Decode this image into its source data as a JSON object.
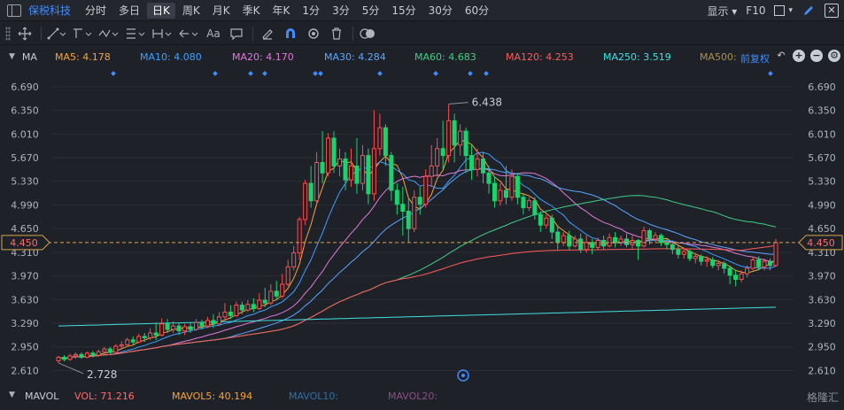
{
  "topbar": {
    "stock_name": "保税科技",
    "periods": [
      "分时",
      "多日",
      "日K",
      "周K",
      "月K",
      "季K",
      "年K",
      "1分",
      "3分",
      "5分",
      "15分",
      "30分",
      "60分"
    ],
    "active_period": "日K",
    "display_label": "显示",
    "f10_label": "F10"
  },
  "toolbar": {
    "text_tool_label": "Aa",
    "icons": [
      "move-icon",
      "line-icon",
      "polyline-icon",
      "wave-icon",
      "range-icon",
      "arrow-left-icon",
      "text-icon",
      "comment-icon",
      "eraser-icon",
      "magnet-icon",
      "eye-icon",
      "trash-icon",
      "toggle-icon"
    ]
  },
  "ma_bar": {
    "indicator": "MA",
    "items": [
      {
        "label": "MA5: 4.178",
        "color": "#f6a43a"
      },
      {
        "label": "MA10: 4.080",
        "color": "#3ea0ff"
      },
      {
        "label": "MA20: 4.170",
        "color": "#e07ad8"
      },
      {
        "label": "MA30: 4.284",
        "color": "#5aa6ff"
      },
      {
        "label": "MA60: 4.683",
        "color": "#3ecf83"
      },
      {
        "label": "MA120: 4.253",
        "color": "#ff5a5a"
      },
      {
        "label": "MA250: 3.519",
        "color": "#3fe0e0"
      },
      {
        "label": "MA500:",
        "color": "#a89050"
      }
    ],
    "adjust_label": "前复权"
  },
  "chart_data": {
    "type": "candlestick",
    "y_ticks": [
      "6.690",
      "6.350",
      "6.010",
      "5.670",
      "5.330",
      "4.990",
      "4.650",
      "4.310",
      "3.970",
      "3.630",
      "3.290",
      "2.950",
      "2.610"
    ],
    "ylim": [
      2.45,
      6.93
    ],
    "current_price": "4.450",
    "max_label": "6.438",
    "min_label": "2.728",
    "colors": {
      "up": "#ff4d4f",
      "down": "#19d46c",
      "current_line": "#d7a24a"
    },
    "candles": [
      [
        2.75,
        2.8,
        2.72,
        2.82
      ],
      [
        2.8,
        2.77,
        2.74,
        2.83
      ],
      [
        2.77,
        2.82,
        2.75,
        2.85
      ],
      [
        2.82,
        2.84,
        2.78,
        2.87
      ],
      [
        2.84,
        2.8,
        2.78,
        2.87
      ],
      [
        2.8,
        2.86,
        2.79,
        2.88
      ],
      [
        2.86,
        2.83,
        2.8,
        2.89
      ],
      [
        2.83,
        2.88,
        2.81,
        2.91
      ],
      [
        2.88,
        2.92,
        2.85,
        2.95
      ],
      [
        2.92,
        2.87,
        2.85,
        2.95
      ],
      [
        2.87,
        2.96,
        2.86,
        2.99
      ],
      [
        2.96,
        2.98,
        2.92,
        3.03
      ],
      [
        2.98,
        3.05,
        2.95,
        3.08
      ],
      [
        3.05,
        3.02,
        2.98,
        3.1
      ],
      [
        3.02,
        3.1,
        3.0,
        3.14
      ],
      [
        3.1,
        3.08,
        3.02,
        3.15
      ],
      [
        3.08,
        3.15,
        3.05,
        3.22
      ],
      [
        3.15,
        3.12,
        3.05,
        3.3
      ],
      [
        3.12,
        3.28,
        3.1,
        3.36
      ],
      [
        3.28,
        3.2,
        3.15,
        3.35
      ],
      [
        3.2,
        3.25,
        3.15,
        3.32
      ],
      [
        3.25,
        3.18,
        3.12,
        3.3
      ],
      [
        3.18,
        3.24,
        3.12,
        3.28
      ],
      [
        3.24,
        3.2,
        3.15,
        3.3
      ],
      [
        3.2,
        3.3,
        3.18,
        3.35
      ],
      [
        3.3,
        3.25,
        3.2,
        3.34
      ],
      [
        3.25,
        3.33,
        3.22,
        3.38
      ],
      [
        3.33,
        3.28,
        3.22,
        3.42
      ],
      [
        3.28,
        3.38,
        3.25,
        3.45
      ],
      [
        3.38,
        3.45,
        3.32,
        3.58
      ],
      [
        3.45,
        3.4,
        3.35,
        3.55
      ],
      [
        3.4,
        3.55,
        3.38,
        3.6
      ],
      [
        3.55,
        3.48,
        3.42,
        3.6
      ],
      [
        3.48,
        3.56,
        3.45,
        3.62
      ],
      [
        3.56,
        3.5,
        3.45,
        3.65
      ],
      [
        3.5,
        3.62,
        3.48,
        3.72
      ],
      [
        3.62,
        3.58,
        3.52,
        3.8
      ],
      [
        3.58,
        3.75,
        3.55,
        3.85
      ],
      [
        3.75,
        3.68,
        3.62,
        3.9
      ],
      [
        3.68,
        3.85,
        3.65,
        4.0
      ],
      [
        3.85,
        4.1,
        3.82,
        4.2
      ],
      [
        4.1,
        4.3,
        4.05,
        4.4
      ],
      [
        4.3,
        4.78,
        4.2,
        4.82
      ],
      [
        4.78,
        5.3,
        4.7,
        5.35
      ],
      [
        5.3,
        5.05,
        4.95,
        5.55
      ],
      [
        5.05,
        5.6,
        5.0,
        5.75
      ],
      [
        5.6,
        5.45,
        5.3,
        6.05
      ],
      [
        5.45,
        5.95,
        5.4,
        6.02
      ],
      [
        5.95,
        5.55,
        5.45,
        6.05
      ],
      [
        5.55,
        5.65,
        5.4,
        5.8
      ],
      [
        5.65,
        5.35,
        5.2,
        5.75
      ],
      [
        5.35,
        5.55,
        5.25,
        5.8
      ],
      [
        5.55,
        5.3,
        5.15,
        5.95
      ],
      [
        5.3,
        5.7,
        5.2,
        5.85
      ],
      [
        5.7,
        5.15,
        5.0,
        5.8
      ],
      [
        5.15,
        5.8,
        5.05,
        6.35
      ],
      [
        5.8,
        6.1,
        5.7,
        6.3
      ],
      [
        6.1,
        5.7,
        5.55,
        6.15
      ],
      [
        5.7,
        5.2,
        5.05,
        5.75
      ],
      [
        5.2,
        5.0,
        4.85,
        5.3
      ],
      [
        5.0,
        4.9,
        4.55,
        5.25
      ],
      [
        4.9,
        4.65,
        4.45,
        5.1
      ],
      [
        4.65,
        5.1,
        4.6,
        5.2
      ],
      [
        5.1,
        5.0,
        4.85,
        5.25
      ],
      [
        5.0,
        5.4,
        4.95,
        5.5
      ],
      [
        5.4,
        5.55,
        5.25,
        5.85
      ],
      [
        5.55,
        5.8,
        5.4,
        5.95
      ],
      [
        5.8,
        5.7,
        5.5,
        6.2
      ],
      [
        5.7,
        6.2,
        5.6,
        6.44
      ],
      [
        6.2,
        5.85,
        5.6,
        6.3
      ],
      [
        5.85,
        6.05,
        5.7,
        6.15
      ],
      [
        6.05,
        5.7,
        5.45,
        6.1
      ],
      [
        5.7,
        5.5,
        5.35,
        5.85
      ],
      [
        5.5,
        5.65,
        5.4,
        5.8
      ],
      [
        5.65,
        5.45,
        5.3,
        5.75
      ],
      [
        5.45,
        5.3,
        5.15,
        5.55
      ],
      [
        5.3,
        5.05,
        4.95,
        5.4
      ],
      [
        5.05,
        5.2,
        4.98,
        5.3
      ],
      [
        5.2,
        5.1,
        5.0,
        5.55
      ],
      [
        5.1,
        5.4,
        5.05,
        5.5
      ],
      [
        5.4,
        5.1,
        5.0,
        5.45
      ],
      [
        5.1,
        4.95,
        4.85,
        5.15
      ],
      [
        4.95,
        5.05,
        4.9,
        5.1
      ],
      [
        5.05,
        4.85,
        4.78,
        5.1
      ],
      [
        4.85,
        4.7,
        4.6,
        4.9
      ],
      [
        4.7,
        4.8,
        4.65,
        4.85
      ],
      [
        4.8,
        4.6,
        4.5,
        4.85
      ],
      [
        4.6,
        4.45,
        4.35,
        4.7
      ],
      [
        4.45,
        4.55,
        4.4,
        4.6
      ],
      [
        4.55,
        4.4,
        4.35,
        4.62
      ],
      [
        4.4,
        4.5,
        4.38,
        4.55
      ],
      [
        4.5,
        4.35,
        4.3,
        4.58
      ],
      [
        4.35,
        4.45,
        4.3,
        4.55
      ],
      [
        4.45,
        4.38,
        4.28,
        4.5
      ],
      [
        4.38,
        4.48,
        4.35,
        4.52
      ],
      [
        4.48,
        4.4,
        4.35,
        4.55
      ],
      [
        4.4,
        4.52,
        4.38,
        4.58
      ],
      [
        4.52,
        4.45,
        4.38,
        4.6
      ],
      [
        4.45,
        4.5,
        4.4,
        4.55
      ],
      [
        4.5,
        4.42,
        4.38,
        4.58
      ],
      [
        4.42,
        4.48,
        4.35,
        4.55
      ],
      [
        4.48,
        4.4,
        4.2,
        4.5
      ],
      [
        4.4,
        4.62,
        4.38,
        4.68
      ],
      [
        4.62,
        4.5,
        4.42,
        4.65
      ],
      [
        4.5,
        4.55,
        4.45,
        4.6
      ],
      [
        4.55,
        4.45,
        4.4,
        4.58
      ],
      [
        4.45,
        4.42,
        4.35,
        4.5
      ],
      [
        4.42,
        4.35,
        4.28,
        4.48
      ],
      [
        4.35,
        4.28,
        4.22,
        4.4
      ],
      [
        4.28,
        4.32,
        4.22,
        4.38
      ],
      [
        4.32,
        4.22,
        4.18,
        4.35
      ],
      [
        4.22,
        4.25,
        4.15,
        4.3
      ],
      [
        4.25,
        4.18,
        4.12,
        4.28
      ],
      [
        4.18,
        4.2,
        4.1,
        4.25
      ],
      [
        4.2,
        4.12,
        4.08,
        4.24
      ],
      [
        4.12,
        4.15,
        4.05,
        4.2
      ],
      [
        4.15,
        4.08,
        4.0,
        4.18
      ],
      [
        4.08,
        3.98,
        3.85,
        4.12
      ],
      [
        3.98,
        3.92,
        3.82,
        4.05
      ],
      [
        3.92,
        4.0,
        3.88,
        4.05
      ],
      [
        4.0,
        4.08,
        3.95,
        4.12
      ],
      [
        4.08,
        4.2,
        4.05,
        4.25
      ],
      [
        4.2,
        4.1,
        4.05,
        4.25
      ],
      [
        4.1,
        4.18,
        4.05,
        4.22
      ],
      [
        4.18,
        4.12,
        4.05,
        4.22
      ],
      [
        4.12,
        4.45,
        4.1,
        4.5
      ]
    ]
  },
  "vol_bar": {
    "indicator": "MAVOL",
    "items": [
      {
        "label": "VOL: 71.216",
        "color": "#ff6b6b"
      },
      {
        "label": "MAVOL5: 40.194",
        "color": "#f6a43a"
      },
      {
        "label": "MAVOL10:",
        "color": "#2f6fa8"
      },
      {
        "label": "MAVOL20:",
        "color": "#8a4f86"
      }
    ],
    "watermark": "格隆汇"
  }
}
